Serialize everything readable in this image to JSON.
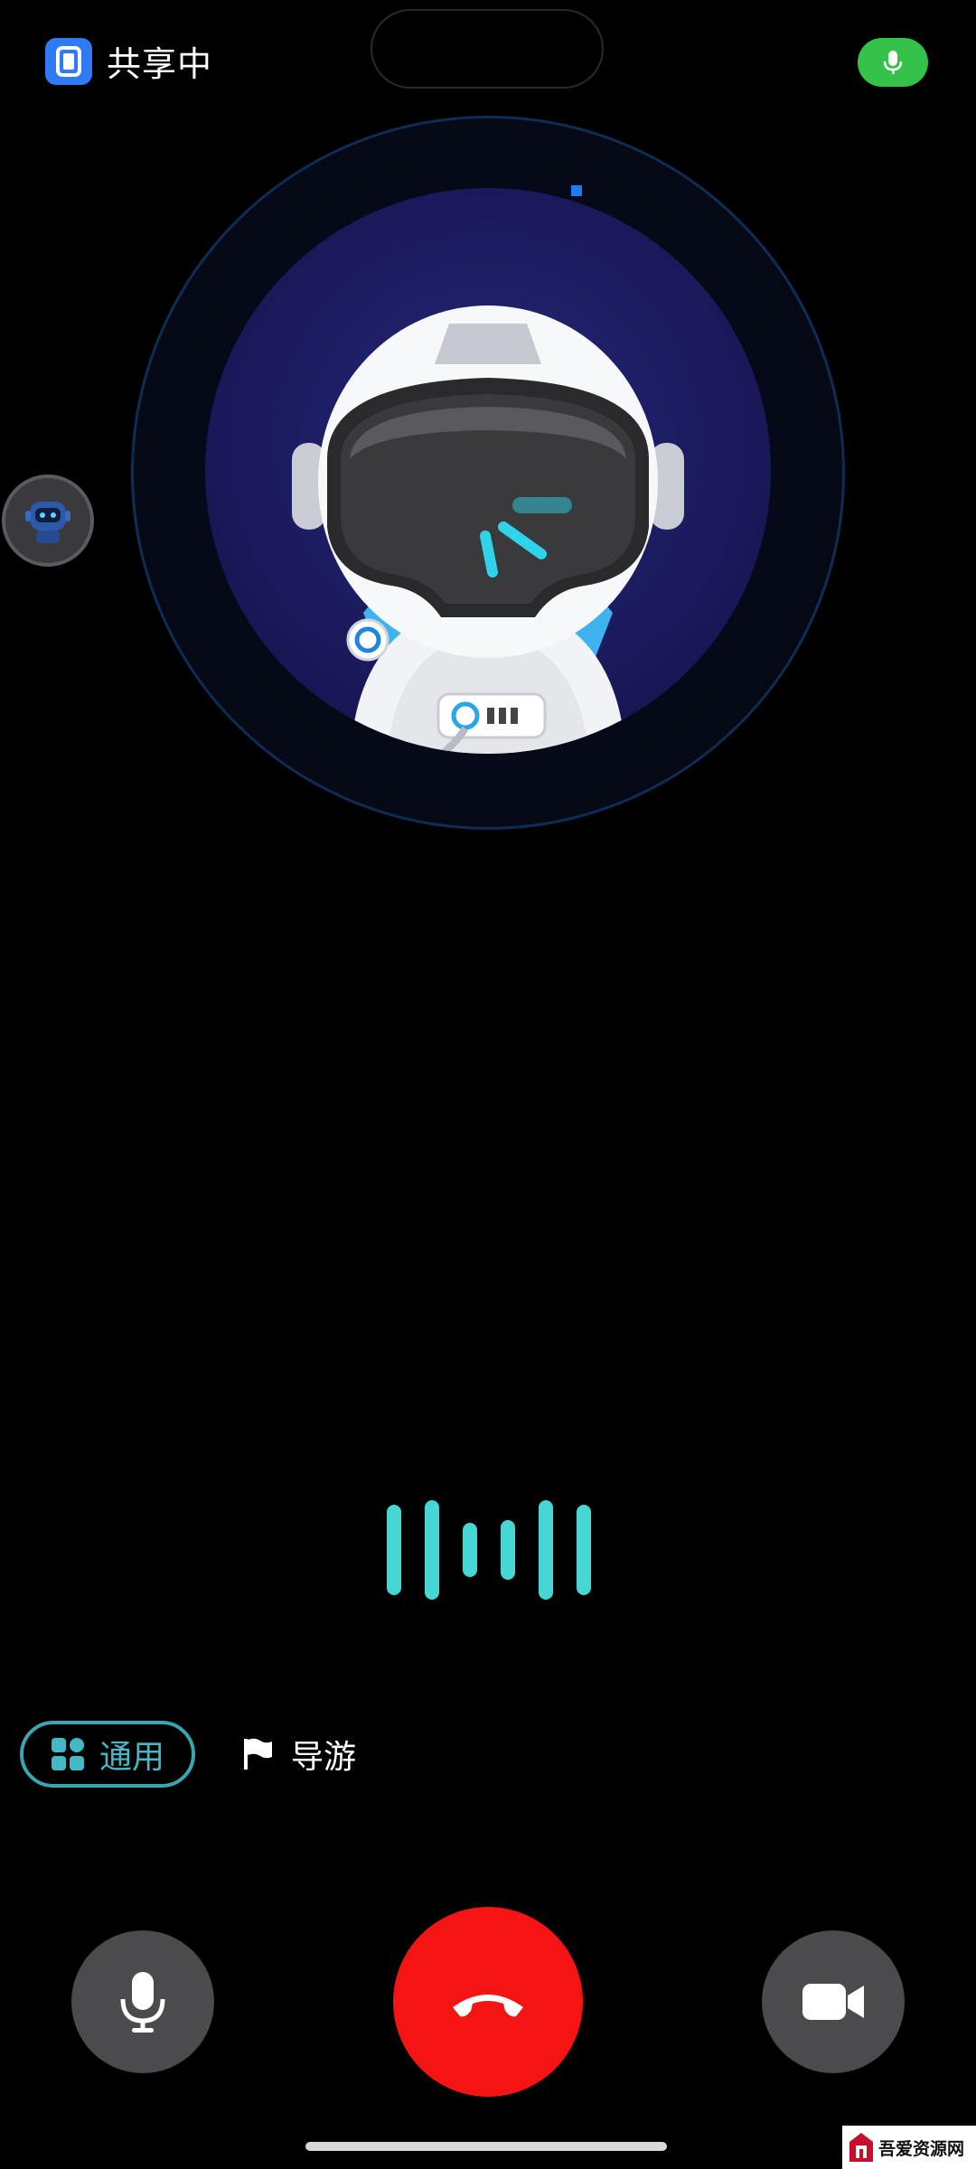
{
  "status_bar": {
    "share_label": "共享中",
    "share_icon": "screen-share-icon",
    "mic_status_icon": "microphone-icon",
    "mic_status_color": "#34c24a"
  },
  "assistant": {
    "avatar": "astronaut-robot-avatar",
    "side_avatar": "mini-robot-avatar",
    "accent_color": "#46d6d3"
  },
  "modes": {
    "general": {
      "label": "通用",
      "icon": "grid-icon",
      "selected": true
    },
    "guide": {
      "label": "导游",
      "icon": "flag-icon",
      "selected": false
    }
  },
  "controls": {
    "mic": {
      "icon": "microphone-icon"
    },
    "hangup": {
      "icon": "hang-up-phone-icon",
      "color": "#f41414"
    },
    "camera": {
      "icon": "video-camera-icon"
    }
  },
  "watermark": {
    "text": "吾爱资源网"
  }
}
